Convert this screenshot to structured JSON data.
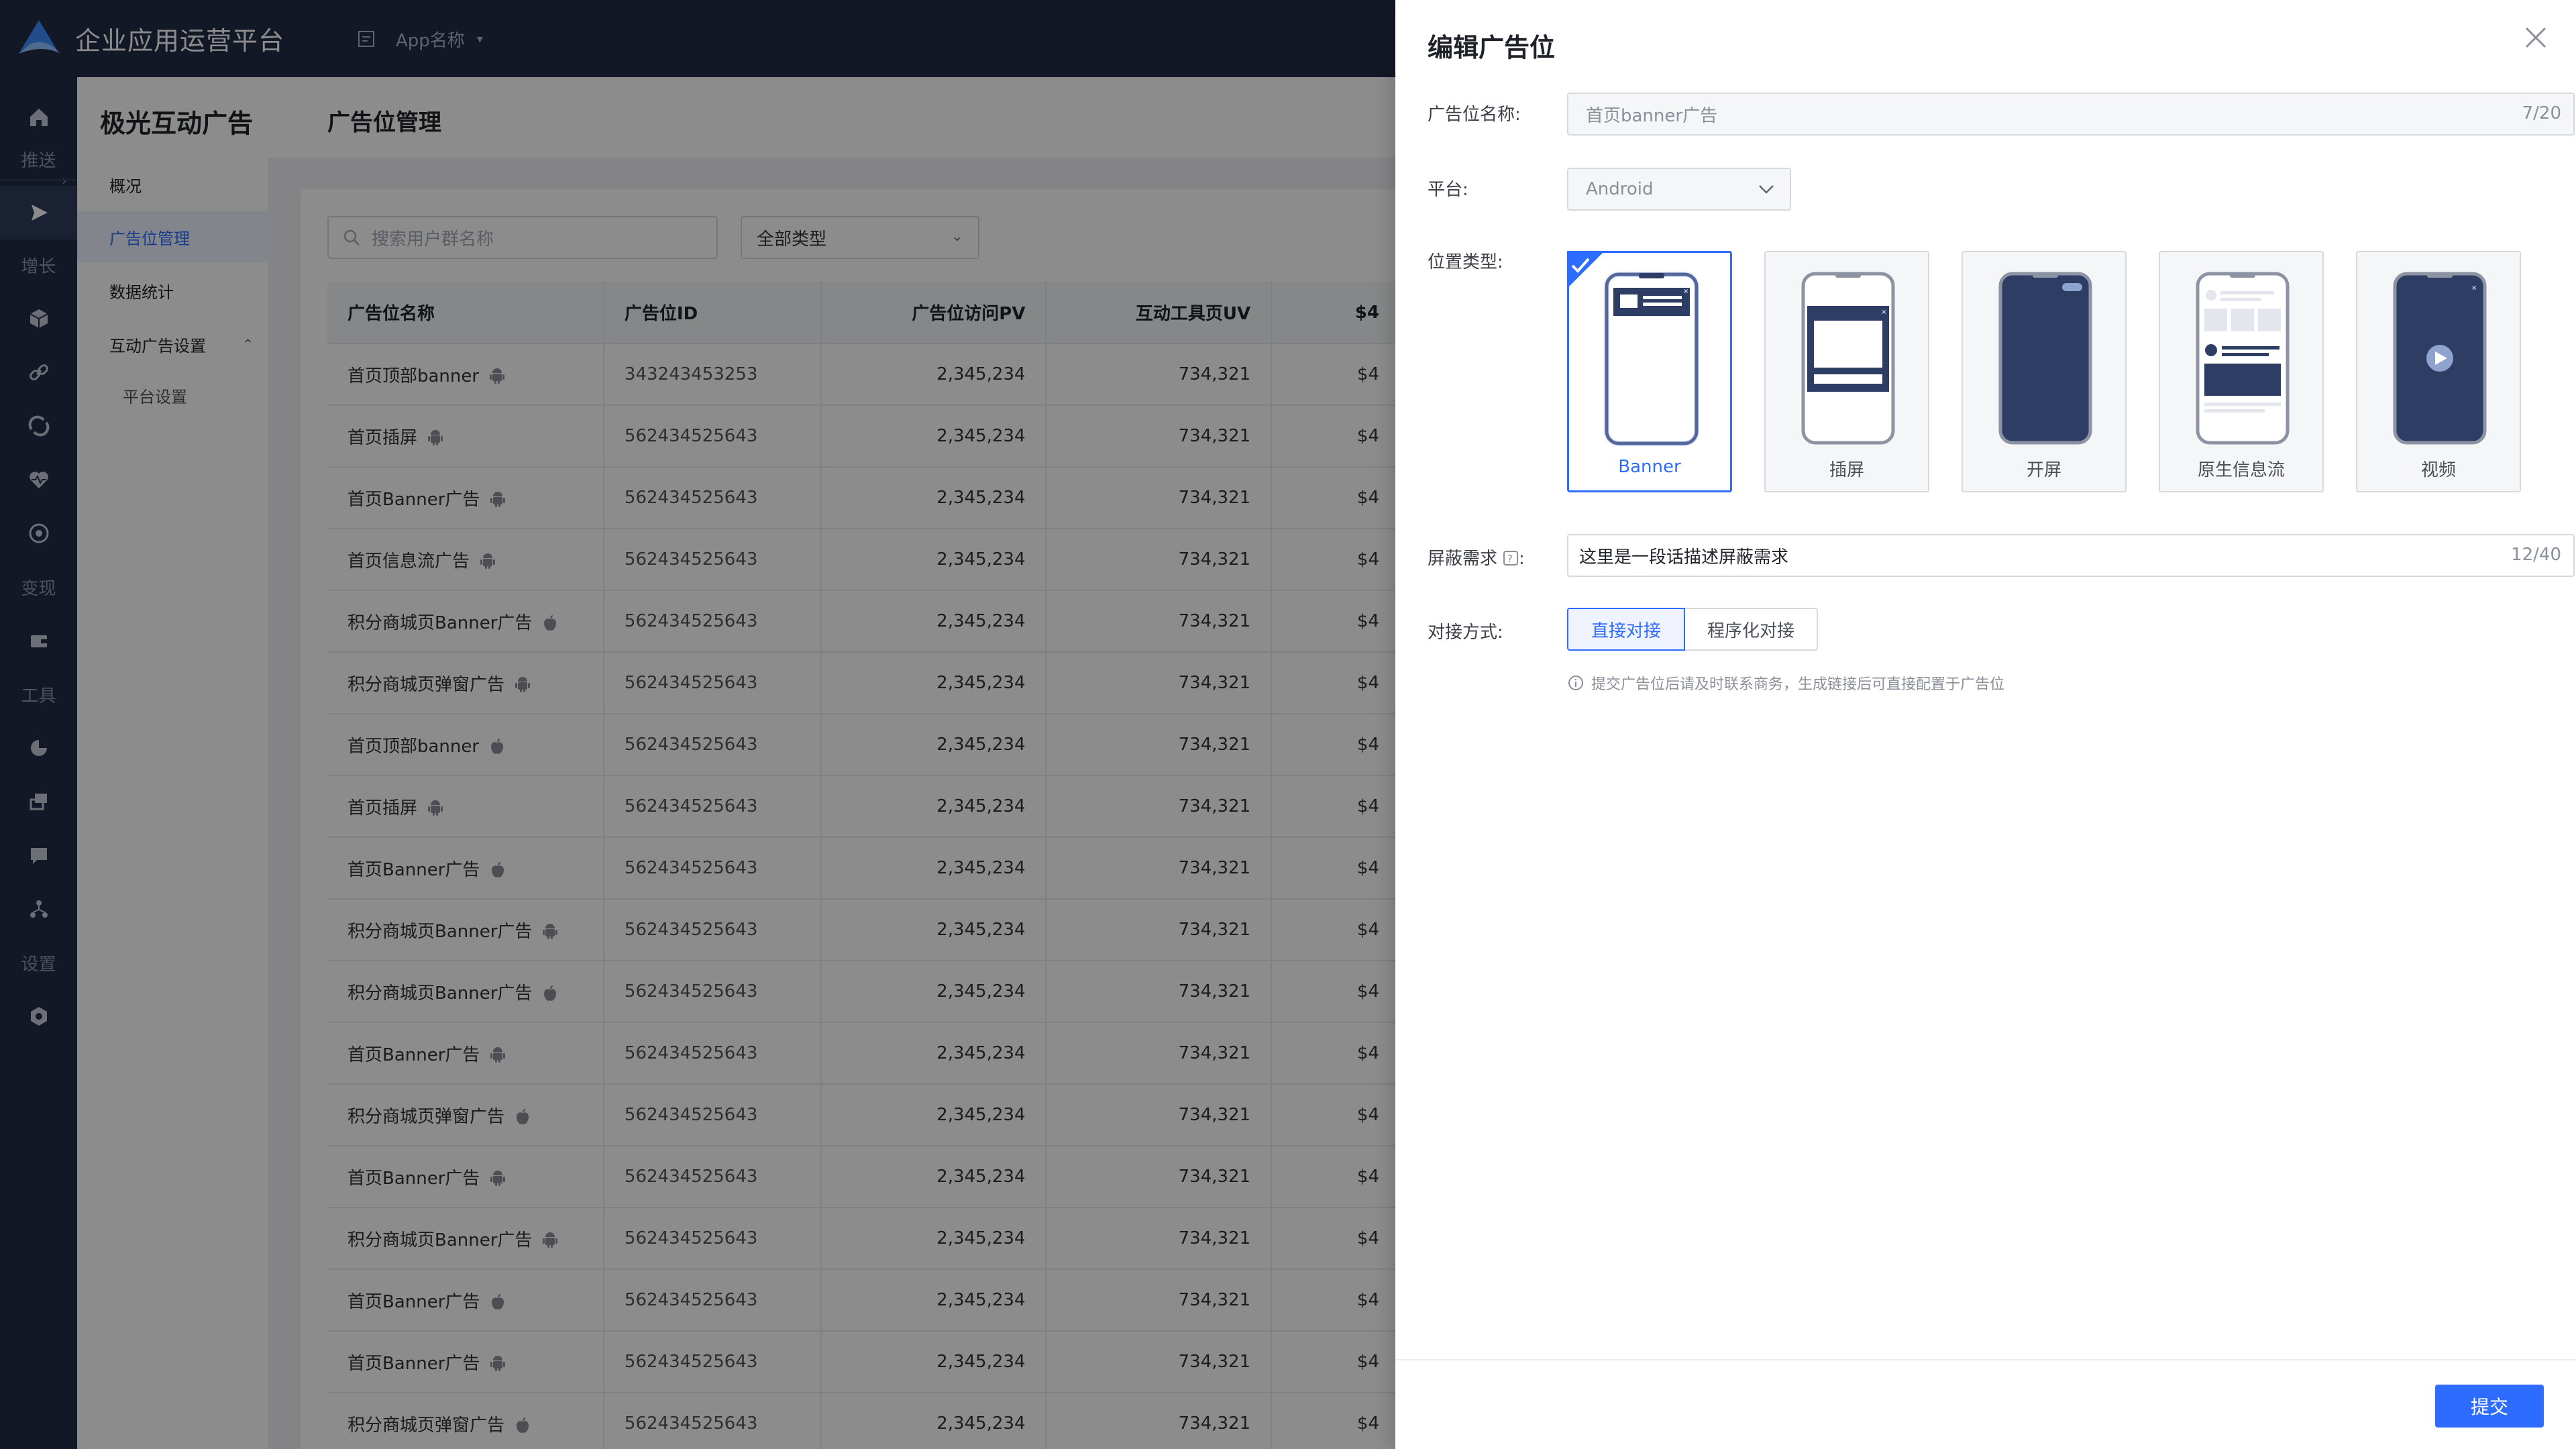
{
  "topbar": {
    "title": "企业应用运营平台",
    "app_name": "App名称"
  },
  "rail": {
    "sections": [
      "推送",
      "增长",
      "变现",
      "工具",
      "设置"
    ]
  },
  "subnav": {
    "title": "极光互动广告",
    "items": [
      "概况",
      "广告位管理",
      "数据统计",
      "互动广告设置",
      "平台设置"
    ]
  },
  "main": {
    "title": "广告位管理",
    "search_placeholder": "搜索用户群名称",
    "type_filter": "全部类型",
    "columns": [
      "广告位名称",
      "广告位ID",
      "广告位访问PV",
      "互动工具页UV",
      "$4"
    ],
    "rows": [
      {
        "name": "首页顶部banner",
        "os": "android",
        "id": "343243453253",
        "pv": "2,345,234",
        "uv": "734,321",
        "extra": "$4"
      },
      {
        "name": "首页插屏",
        "os": "android",
        "id": "562434525643",
        "pv": "2,345,234",
        "uv": "734,321",
        "extra": "$4"
      },
      {
        "name": "首页Banner广告",
        "os": "android",
        "id": "562434525643",
        "pv": "2,345,234",
        "uv": "734,321",
        "extra": "$4"
      },
      {
        "name": "首页信息流广告",
        "os": "android",
        "id": "562434525643",
        "pv": "2,345,234",
        "uv": "734,321",
        "extra": "$4"
      },
      {
        "name": "积分商城页Banner广告",
        "os": "apple",
        "id": "562434525643",
        "pv": "2,345,234",
        "uv": "734,321",
        "extra": "$4"
      },
      {
        "name": "积分商城页弹窗广告",
        "os": "android",
        "id": "562434525643",
        "pv": "2,345,234",
        "uv": "734,321",
        "extra": "$4"
      },
      {
        "name": "首页顶部banner",
        "os": "apple",
        "id": "562434525643",
        "pv": "2,345,234",
        "uv": "734,321",
        "extra": "$4"
      },
      {
        "name": "首页插屏",
        "os": "android",
        "id": "562434525643",
        "pv": "2,345,234",
        "uv": "734,321",
        "extra": "$4"
      },
      {
        "name": "首页Banner广告",
        "os": "apple",
        "id": "562434525643",
        "pv": "2,345,234",
        "uv": "734,321",
        "extra": "$4"
      },
      {
        "name": "积分商城页Banner广告",
        "os": "android",
        "id": "562434525643",
        "pv": "2,345,234",
        "uv": "734,321",
        "extra": "$4"
      },
      {
        "name": "积分商城页Banner广告",
        "os": "apple",
        "id": "562434525643",
        "pv": "2,345,234",
        "uv": "734,321",
        "extra": "$4"
      },
      {
        "name": "首页Banner广告",
        "os": "android",
        "id": "562434525643",
        "pv": "2,345,234",
        "uv": "734,321",
        "extra": "$4"
      },
      {
        "name": "积分商城页弹窗广告",
        "os": "apple",
        "id": "562434525643",
        "pv": "2,345,234",
        "uv": "734,321",
        "extra": "$4"
      },
      {
        "name": "首页Banner广告",
        "os": "android",
        "id": "562434525643",
        "pv": "2,345,234",
        "uv": "734,321",
        "extra": "$4"
      },
      {
        "name": "积分商城页Banner广告",
        "os": "android",
        "id": "562434525643",
        "pv": "2,345,234",
        "uv": "734,321",
        "extra": "$4"
      },
      {
        "name": "首页Banner广告",
        "os": "apple",
        "id": "562434525643",
        "pv": "2,345,234",
        "uv": "734,321",
        "extra": "$4"
      },
      {
        "name": "首页Banner广告",
        "os": "android",
        "id": "562434525643",
        "pv": "2,345,234",
        "uv": "734,321",
        "extra": "$4"
      },
      {
        "name": "积分商城页弹窗广告",
        "os": "apple",
        "id": "562434525643",
        "pv": "2,345,234",
        "uv": "734,321",
        "extra": "$4"
      }
    ]
  },
  "drawer": {
    "title": "编辑广告位",
    "name_label": "广告位名称:",
    "name_value": "首页banner广告",
    "name_count": "7/20",
    "platform_label": "平台:",
    "platform_value": "Android",
    "position_label": "位置类型:",
    "position_types": [
      "Banner",
      "插屏",
      "开屏",
      "原生信息流",
      "视频"
    ],
    "selected_position": "Banner",
    "shield_label": "屏蔽需求",
    "shield_label_suffix": ":",
    "shield_value": "这里是一段话描述屏蔽需求",
    "shield_count": "12/40",
    "connect_label": "对接方式:",
    "connect_options": [
      "直接对接",
      "程序化对接"
    ],
    "connect_selected": "直接对接",
    "hint": "提交广告位后请及时联系商务，生成链接后可直接配置于广告位",
    "submit": "提交"
  },
  "colors": {
    "primary": "#2d6cff",
    "nav_bg": "#232d45",
    "phone_fill": "#2e3d63"
  }
}
